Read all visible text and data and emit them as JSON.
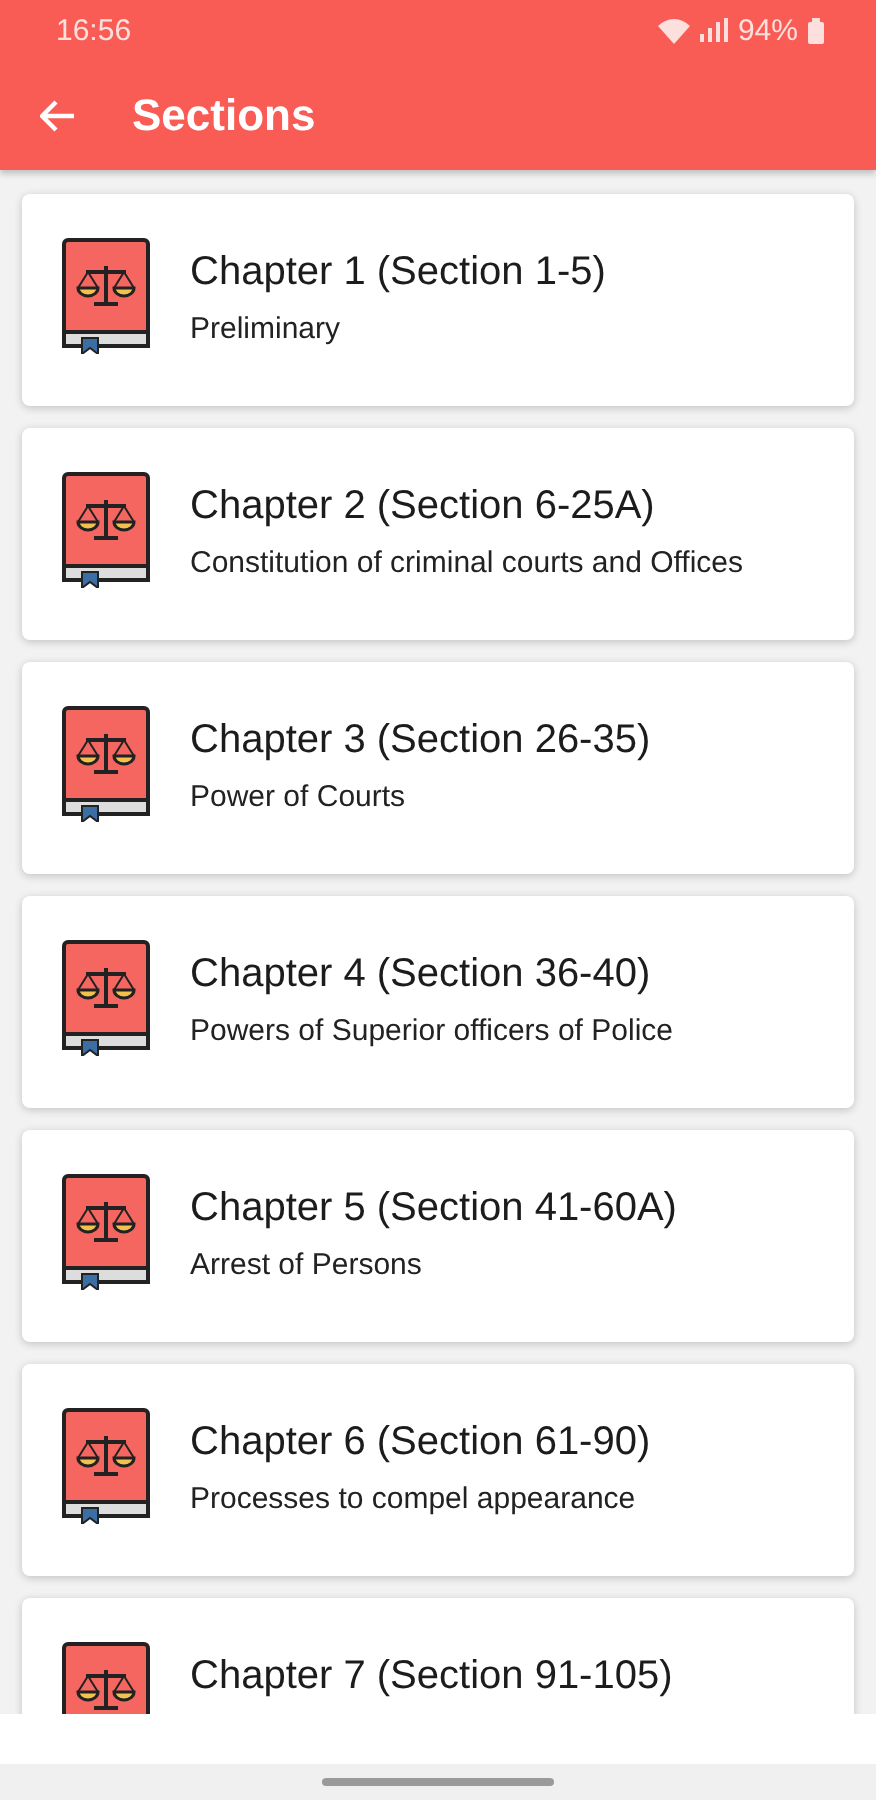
{
  "status_bar": {
    "time": "16:56",
    "battery": "94%"
  },
  "app_bar": {
    "title": "Sections"
  },
  "chapters": [
    {
      "title": "Chapter 1 (Section 1-5)",
      "subtitle": "Preliminary"
    },
    {
      "title": "Chapter 2 (Section 6-25A)",
      "subtitle": "Constitution of criminal courts and Offices"
    },
    {
      "title": "Chapter 3 (Section 26-35)",
      "subtitle": "Power of Courts"
    },
    {
      "title": "Chapter 4 (Section 36-40)",
      "subtitle": "Powers of Superior officers of Police"
    },
    {
      "title": "Chapter 5 (Section 41-60A)",
      "subtitle": "Arrest of Persons"
    },
    {
      "title": "Chapter 6 (Section 61-90)",
      "subtitle": "Processes to compel appearance"
    },
    {
      "title": "Chapter 7 (Section 91-105)"
    }
  ]
}
